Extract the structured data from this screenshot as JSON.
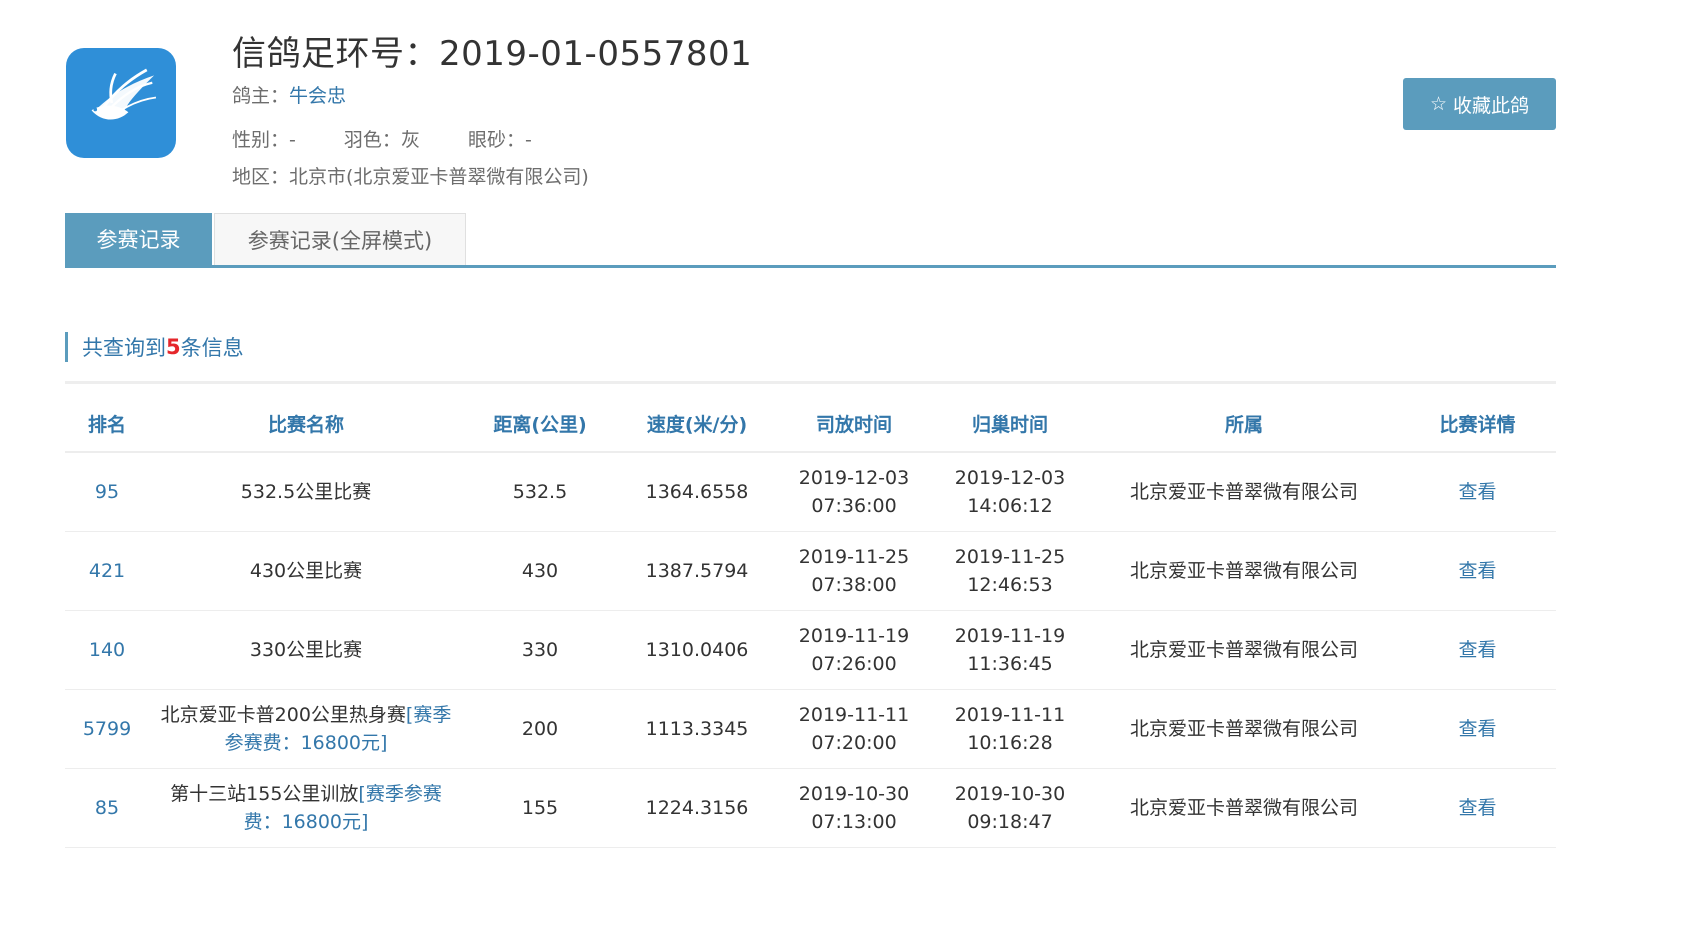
{
  "header": {
    "title": "信鸽足环号：2019-01-0557801",
    "owner_label": "鸽主：",
    "owner_name": "牛会忠",
    "gender_label": "性别：",
    "gender_value": "-",
    "feather_label": "羽色：",
    "feather_value": "灰",
    "eye_label": "眼砂：",
    "eye_value": "-",
    "region_label": "地区：",
    "region_value": "北京市(北京爱亚卡普翠微有限公司)",
    "favorite_star": "☆",
    "favorite_label": "收藏此鸽",
    "logo_icon": "pigeon-logo-icon"
  },
  "tabs": [
    {
      "label": "参赛记录",
      "active": true
    },
    {
      "label": "参赛记录(全屏模式)",
      "active": false
    }
  ],
  "summary": {
    "prefix": "共查询到",
    "count": "5",
    "suffix": "条信息"
  },
  "table": {
    "headers": [
      "排名",
      "比赛名称",
      "距离(公里)",
      "速度(米/分)",
      "司放时间",
      "归巢时间",
      "所属",
      "比赛详情"
    ],
    "rows": [
      {
        "rank": "95",
        "race_name": "532.5公里比赛",
        "fee_tag": "",
        "distance": "532.5",
        "speed": "1364.6558",
        "release_date": "2019-12-03",
        "release_time": "07:36:00",
        "return_date": "2019-12-03",
        "return_time": "14:06:12",
        "affiliation": "北京爱亚卡普翠微有限公司",
        "detail": "查看"
      },
      {
        "rank": "421",
        "race_name": "430公里比赛",
        "fee_tag": "",
        "distance": "430",
        "speed": "1387.5794",
        "release_date": "2019-11-25",
        "release_time": "07:38:00",
        "return_date": "2019-11-25",
        "return_time": "12:46:53",
        "affiliation": "北京爱亚卡普翠微有限公司",
        "detail": "查看"
      },
      {
        "rank": "140",
        "race_name": "330公里比赛",
        "fee_tag": "",
        "distance": "330",
        "speed": "1310.0406",
        "release_date": "2019-11-19",
        "release_time": "07:26:00",
        "return_date": "2019-11-19",
        "return_time": "11:36:45",
        "affiliation": "北京爱亚卡普翠微有限公司",
        "detail": "查看"
      },
      {
        "rank": "5799",
        "race_name": "北京爱亚卡普200公里热身赛",
        "fee_tag": "[赛季参赛费：16800元]",
        "distance": "200",
        "speed": "1113.3345",
        "release_date": "2019-11-11",
        "release_time": "07:20:00",
        "return_date": "2019-11-11",
        "return_time": "10:16:28",
        "affiliation": "北京爱亚卡普翠微有限公司",
        "detail": "查看"
      },
      {
        "rank": "85",
        "race_name": "第十三站155公里训放",
        "fee_tag": "[赛季参赛费：16800元]",
        "distance": "155",
        "speed": "1224.3156",
        "release_date": "2019-10-30",
        "release_time": "07:13:00",
        "return_date": "2019-10-30",
        "return_time": "09:18:47",
        "affiliation": "北京爱亚卡普翠微有限公司",
        "detail": "查看"
      }
    ]
  }
}
